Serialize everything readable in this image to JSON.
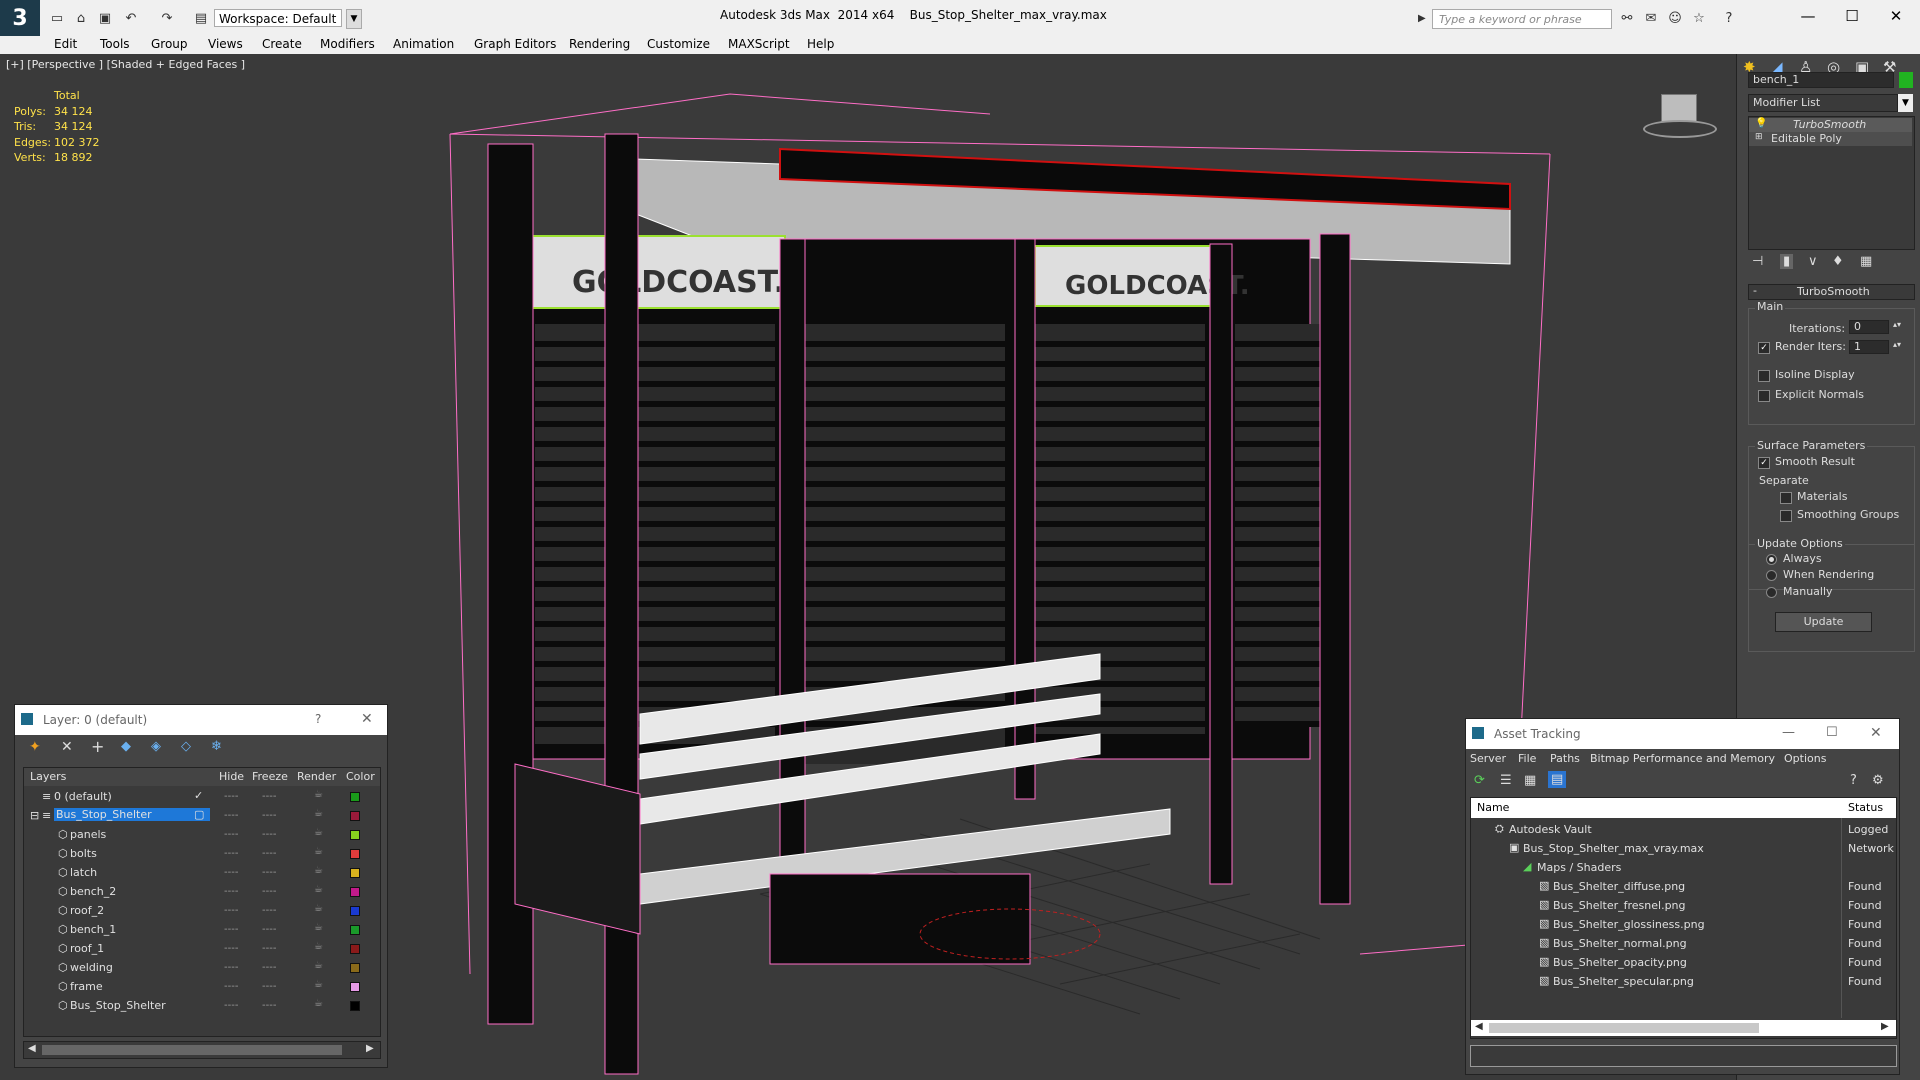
{
  "titlebar": {
    "workspace": "Workspace: Default",
    "app_title": "Autodesk 3ds Max  2014 x64",
    "file_title": "Bus_Stop_Shelter_max_vray.max",
    "search_placeholder": "Type a keyword or phrase"
  },
  "menubar": [
    "Edit",
    "Tools",
    "Group",
    "Views",
    "Create",
    "Modifiers",
    "Animation",
    "Graph Editors",
    "Rendering",
    "Customize",
    "MAXScript",
    "Help"
  ],
  "viewport": {
    "label": "[+] [Perspective ] [Shaded + Edged Faces ]",
    "stats_header": "Total",
    "stats": [
      {
        "k": "Polys:",
        "v": "34 124"
      },
      {
        "k": "Tris:",
        "v": "34 124"
      },
      {
        "k": "Edges:",
        "v": "102 372"
      },
      {
        "k": "Verts:",
        "v": "18 892"
      }
    ],
    "sign_text_1": "GOLDCOAST.",
    "sign_text_2": "GOLDCOAST."
  },
  "command_panel": {
    "object_name": "bench_1",
    "object_color": "#21b321",
    "modifier_list": "Modifier List",
    "stack": [
      "TurboSmooth",
      "Editable Poly"
    ],
    "rollout_title": "TurboSmooth",
    "main_label": "Main",
    "iterations_label": "Iterations:",
    "iterations_value": "0",
    "render_iters_label": "Render Iters:",
    "render_iters_value": "1",
    "isoline": "Isoline Display",
    "explicit_normals": "Explicit Normals",
    "surface_params": "Surface Parameters",
    "smooth_result": "Smooth Result",
    "separate": "Separate",
    "materials": "Materials",
    "smoothing_groups": "Smoothing Groups",
    "update_options": "Update Options",
    "always": "Always",
    "when_rendering": "When Rendering",
    "manually": "Manually",
    "update_btn": "Update"
  },
  "layer_window": {
    "title": "Layer: 0 (default)",
    "help": "?",
    "columns": [
      "Layers",
      "Hide",
      "Freeze",
      "Render",
      "Color"
    ],
    "rows": [
      {
        "name": "0 (default)",
        "color": "#1a9a1a"
      },
      {
        "name": "Bus_Stop_Shelter",
        "color": "#9a1a3a"
      },
      {
        "name": "panels",
        "color": "#86d01e"
      },
      {
        "name": "bolts",
        "color": "#e03c3c"
      },
      {
        "name": "latch",
        "color": "#d8b21e"
      },
      {
        "name": "bench_2",
        "color": "#c21a8a"
      },
      {
        "name": "roof_2",
        "color": "#1a3ad0"
      },
      {
        "name": "bench_1",
        "color": "#1a9a2a"
      },
      {
        "name": "roof_1",
        "color": "#8a1a1a"
      },
      {
        "name": "welding",
        "color": "#8a6a1a"
      },
      {
        "name": "frame",
        "color": "#e69ae6"
      },
      {
        "name": "Bus_Stop_Shelter",
        "color": "#000000"
      }
    ]
  },
  "asset_window": {
    "title": "Asset Tracking",
    "menu": [
      "Server",
      "File",
      "Paths",
      "Bitmap Performance and Memory",
      "Options"
    ],
    "columns": [
      "Name",
      "Status"
    ],
    "rows": [
      {
        "name": "Autodesk Vault",
        "status": "Logged"
      },
      {
        "name": "Bus_Stop_Shelter_max_vray.max",
        "status": "Network"
      },
      {
        "name": "Maps / Shaders",
        "status": ""
      },
      {
        "name": "Bus_Shelter_diffuse.png",
        "status": "Found"
      },
      {
        "name": "Bus_Shelter_fresnel.png",
        "status": "Found"
      },
      {
        "name": "Bus_Shelter_glossiness.png",
        "status": "Found"
      },
      {
        "name": "Bus_Shelter_normal.png",
        "status": "Found"
      },
      {
        "name": "Bus_Shelter_opacity.png",
        "status": "Found"
      },
      {
        "name": "Bus_Shelter_specular.png",
        "status": "Found"
      }
    ]
  }
}
